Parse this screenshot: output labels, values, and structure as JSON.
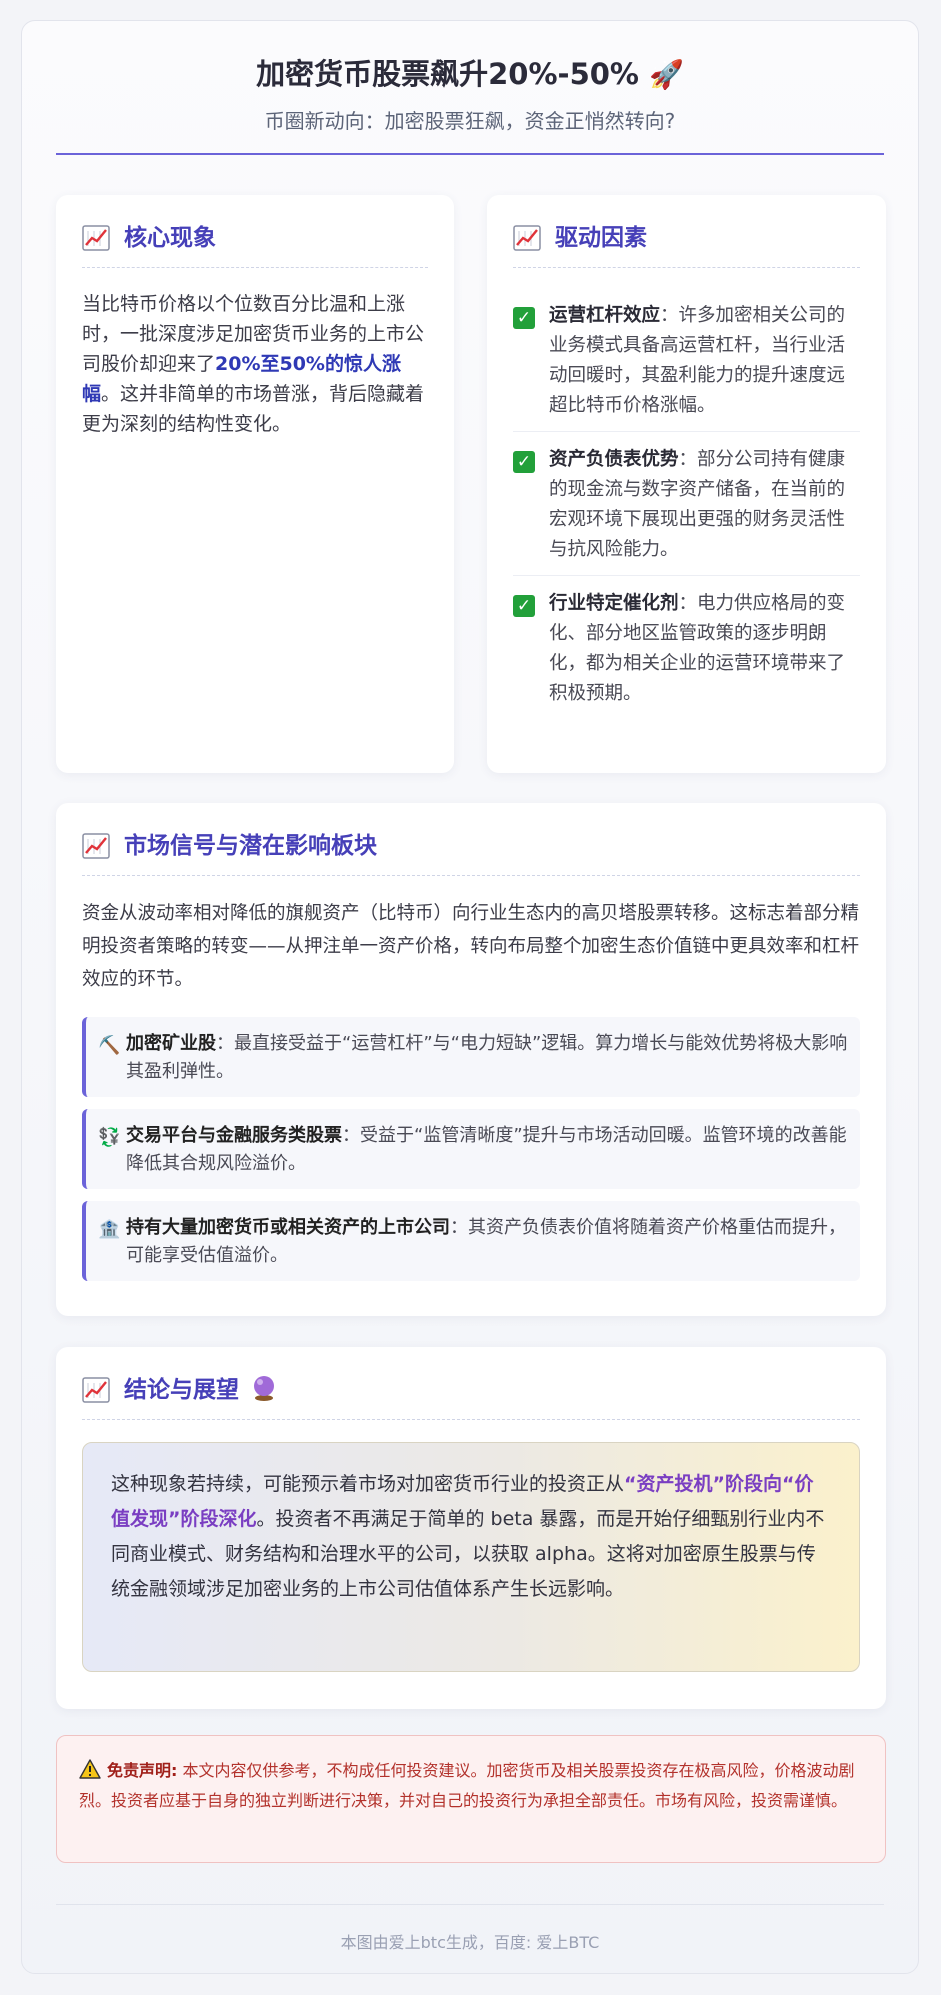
{
  "header": {
    "title": "加密货币股票飙升20%-50%",
    "title_emoji": "🚀",
    "subtitle": "币圈新动向：加密股票狂飙，资金正悄然转向?"
  },
  "core": {
    "heading": "核心现象",
    "text_before": "当比特币价格以个位数百分比温和上涨时，一批深度涉足加密货币业务的上市公司股价却迎来了",
    "highlight": "20%至50%的惊人涨幅",
    "text_after": "。这并非简单的市场普涨，背后隐藏着更为深刻的结构性变化。"
  },
  "drivers": {
    "heading": "驱动因素",
    "items": [
      {
        "title": "运营杠杆效应",
        "text": "：许多加密相关公司的业务模式具备高运营杠杆，当行业活动回暖时，其盈利能力的提升速度远超比特币价格涨幅。"
      },
      {
        "title": "资产负债表优势",
        "text": "：部分公司持有健康的现金流与数字资产储备，在当前的宏观环境下展现出更强的财务灵活性与抗风险能力。"
      },
      {
        "title": "行业特定催化剂",
        "text": "：电力供应格局的变化、部分地区监管政策的逐步明朗化，都为相关企业的运营环境带来了积极预期。"
      }
    ]
  },
  "market": {
    "heading": "市场信号与潜在影响板块",
    "intro": "资金从波动率相对降低的旗舰资产（比特币）向行业生态内的高贝塔股票转移。这标志着部分精明投资者策略的转变——从押注单一资产价格，转向布局整个加密生态价值链中更具效率和杠杆效应的环节。",
    "sectors": [
      {
        "icon": "⛏️",
        "title": "加密矿业股",
        "text": "：最直接受益于“运营杠杆”与“电力短缺”逻辑。算力增长与能效优势将极大影响其盈利弹性。"
      },
      {
        "icon": "💱",
        "title": "交易平台与金融服务类股票",
        "text": "：受益于“监管清晰度”提升与市场活动回暖。监管环境的改善能降低其合规风险溢价。"
      },
      {
        "icon": "🏦",
        "title": "持有大量加密货币或相关资产的上市公司",
        "text": "：其资产负债表价值将随着资产价格重估而提升，可能享受估值溢价。"
      }
    ]
  },
  "outlook": {
    "heading": "结论与展望",
    "text_before": "这种现象若持续，可能预示着市场对加密货币行业的投资正从",
    "highlight": "“资产投机”阶段向“价值发现”阶段深化",
    "text_after": "。投资者不再满足于简单的 beta 暴露，而是开始仔细甄别行业内不同商业模式、财务结构和治理水平的公司，以获取 alpha。这将对加密原生股票与传统金融领域涉足加密业务的上市公司估值体系产生长远影响。"
  },
  "disclaimer": {
    "label": "免责声明:",
    "text": "本文内容仅供参考，不构成任何投资建议。加密货币及相关股票投资存在极高风险，价格波动剧烈。投资者应基于自身的独立判断进行决策，并对自己的投资行为承担全部责任。市场有风险，投资需谨慎。"
  },
  "footer": {
    "text": "本图由爱上btc生成，百度: 爱上BTC"
  },
  "colors": {
    "accent": "#6b63d9",
    "heading": "#4640b8",
    "highlight": "#2f39b5",
    "check": "#22a03a",
    "warning": "#b3322c"
  },
  "icons": {
    "section": "chart-increasing-icon",
    "check": "check-mark-icon",
    "warning": "warning-icon",
    "outlook": "crystal-ball-icon"
  }
}
